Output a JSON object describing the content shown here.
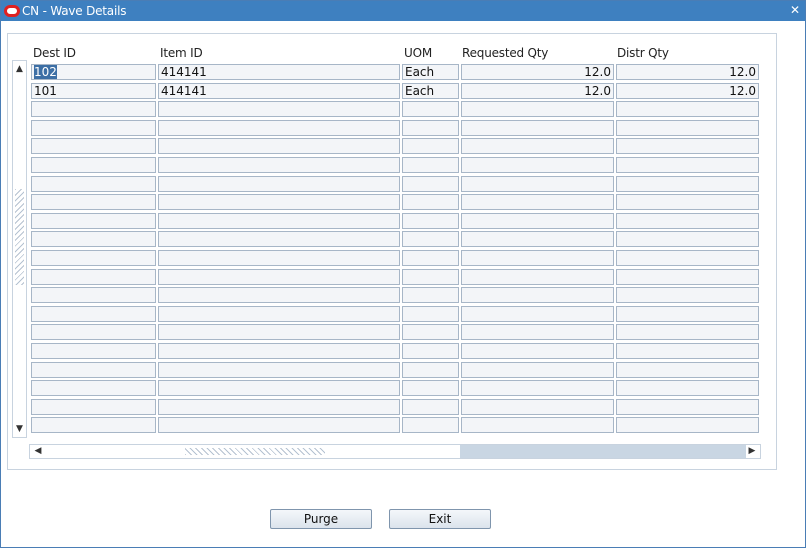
{
  "window": {
    "title": "CN - Wave Details",
    "close_glyph": "✕",
    "icon": "oracle-logo-icon",
    "accent_color": "#3e80c0"
  },
  "table": {
    "columns": [
      "Dest ID",
      "Item ID",
      "UOM",
      "Requested Qty",
      "Distr Qty"
    ],
    "rows": [
      {
        "dest_id": "102",
        "item_id": "414141",
        "uom": "Each",
        "requested_qty": "12.0",
        "distr_qty": "12.0"
      },
      {
        "dest_id": "101",
        "item_id": "414141",
        "uom": "Each",
        "requested_qty": "12.0",
        "distr_qty": "12.0"
      }
    ],
    "empty_rows": 18
  },
  "buttons": {
    "purge": "Purge",
    "exit": "Exit"
  }
}
